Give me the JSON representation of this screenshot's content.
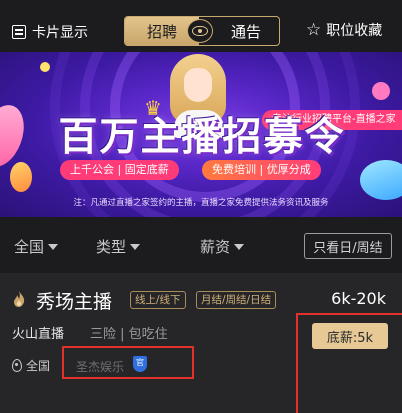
{
  "topbar": {
    "card_display_label": "卡片显示",
    "segment_left_label": "招聘",
    "segment_right_label": "通告",
    "favorites_label": "职位收藏"
  },
  "banner": {
    "tagline": "专注行业招聘平台-直播之家",
    "headline": "百万主播招募令",
    "pill_left": "上千公会 | 固定底薪",
    "pill_right": "免费培训 | 优厚分成",
    "note": "注：凡通过直播之家签约的主播，直播之家免费提供法务资讯及服务"
  },
  "filters": {
    "region": "全国",
    "type": "类型",
    "salary": "薪资",
    "weekend_only": "只看日/周结"
  },
  "job": {
    "title": "秀场主播",
    "tags": [
      "线上/线下",
      "月结/周结/日结"
    ],
    "salary": "6k-20k",
    "platform": "火山直播",
    "benefits": "三险 | 包吃住",
    "base_pay": "底薪:5k",
    "location": "全国",
    "company": "圣杰娱乐",
    "official_badge": "官"
  },
  "colors": {
    "background": "#1c1c1e",
    "card": "#262628",
    "gold": "#e2c58d",
    "highlight_red": "#e2302a",
    "banner_purple": "#5a27c9"
  }
}
